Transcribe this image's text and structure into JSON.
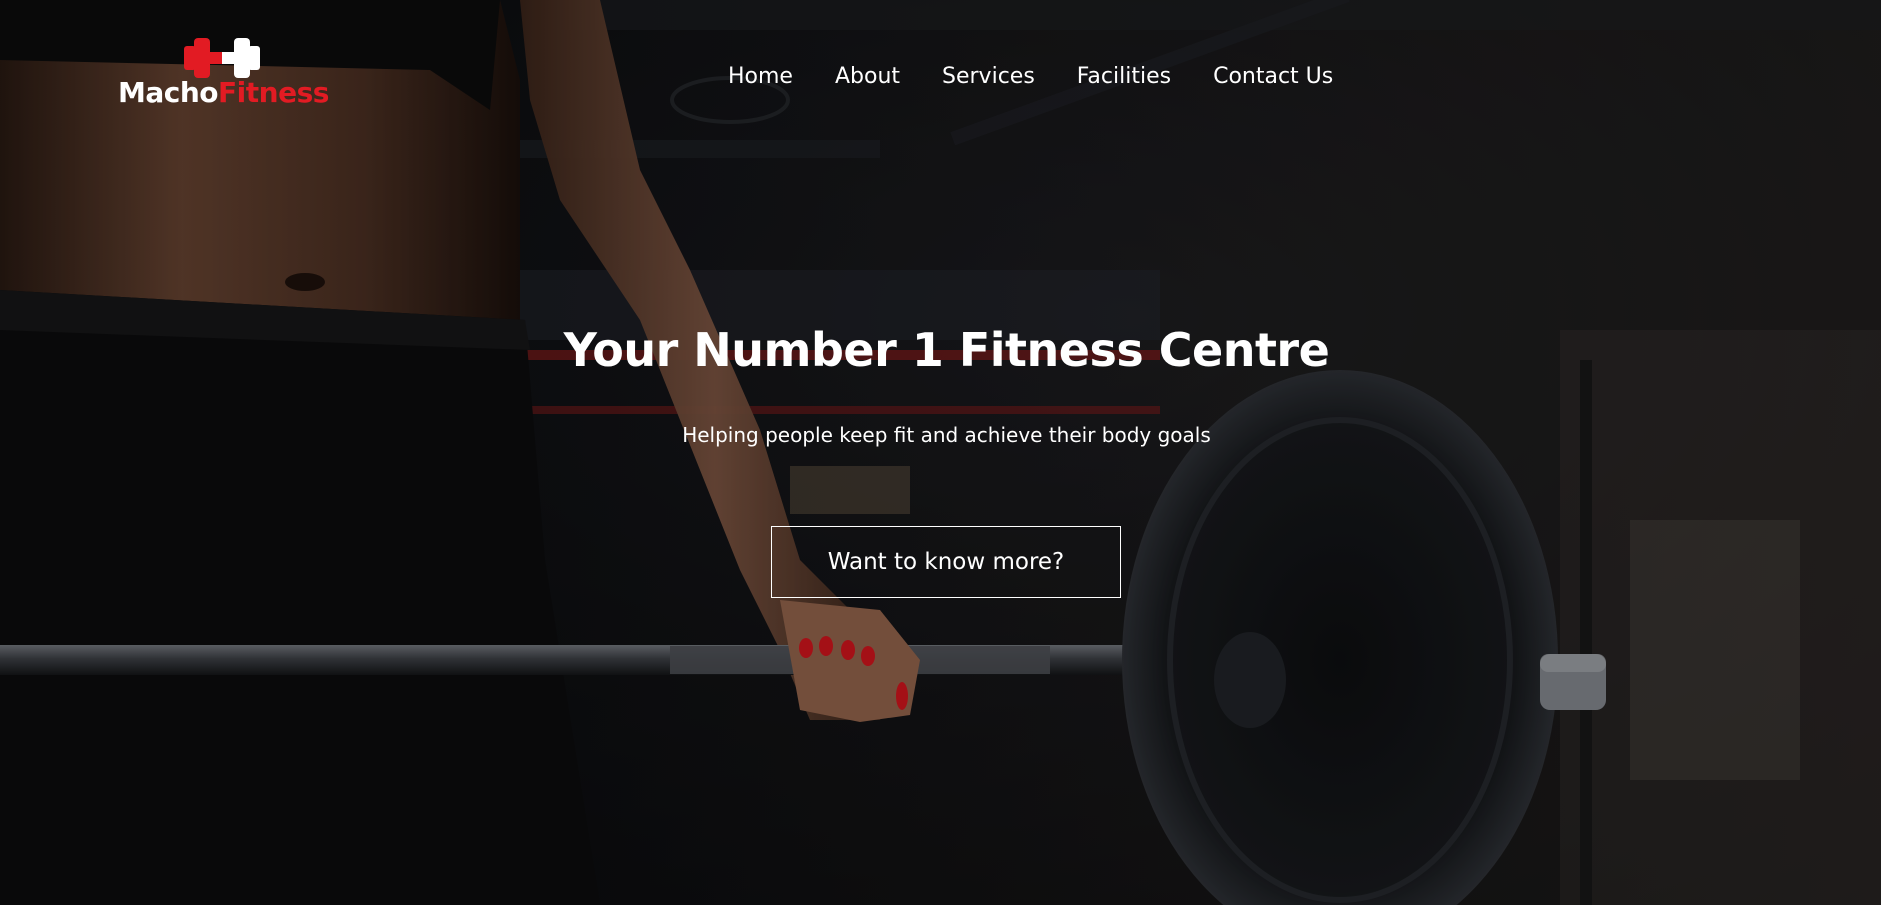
{
  "brand": {
    "logo_word_1": "Macho",
    "logo_word_2": "Fitness",
    "logo_icon": "dumbbell-icon",
    "colors": {
      "primary_text": "#ffffff",
      "accent": "#e21b23",
      "background": "#060606"
    }
  },
  "nav": {
    "items": [
      {
        "label": "Home"
      },
      {
        "label": "About"
      },
      {
        "label": "Services"
      },
      {
        "label": "Facilities"
      },
      {
        "label": "Contact Us"
      }
    ]
  },
  "hero": {
    "title": "Your Number 1 Fitness Centre",
    "subtitle": "Helping people keep fit and achieve their body goals",
    "cta_label": "Want to know more?",
    "background_image": "woman-deadlifting-barbell-in-dark-gym"
  }
}
